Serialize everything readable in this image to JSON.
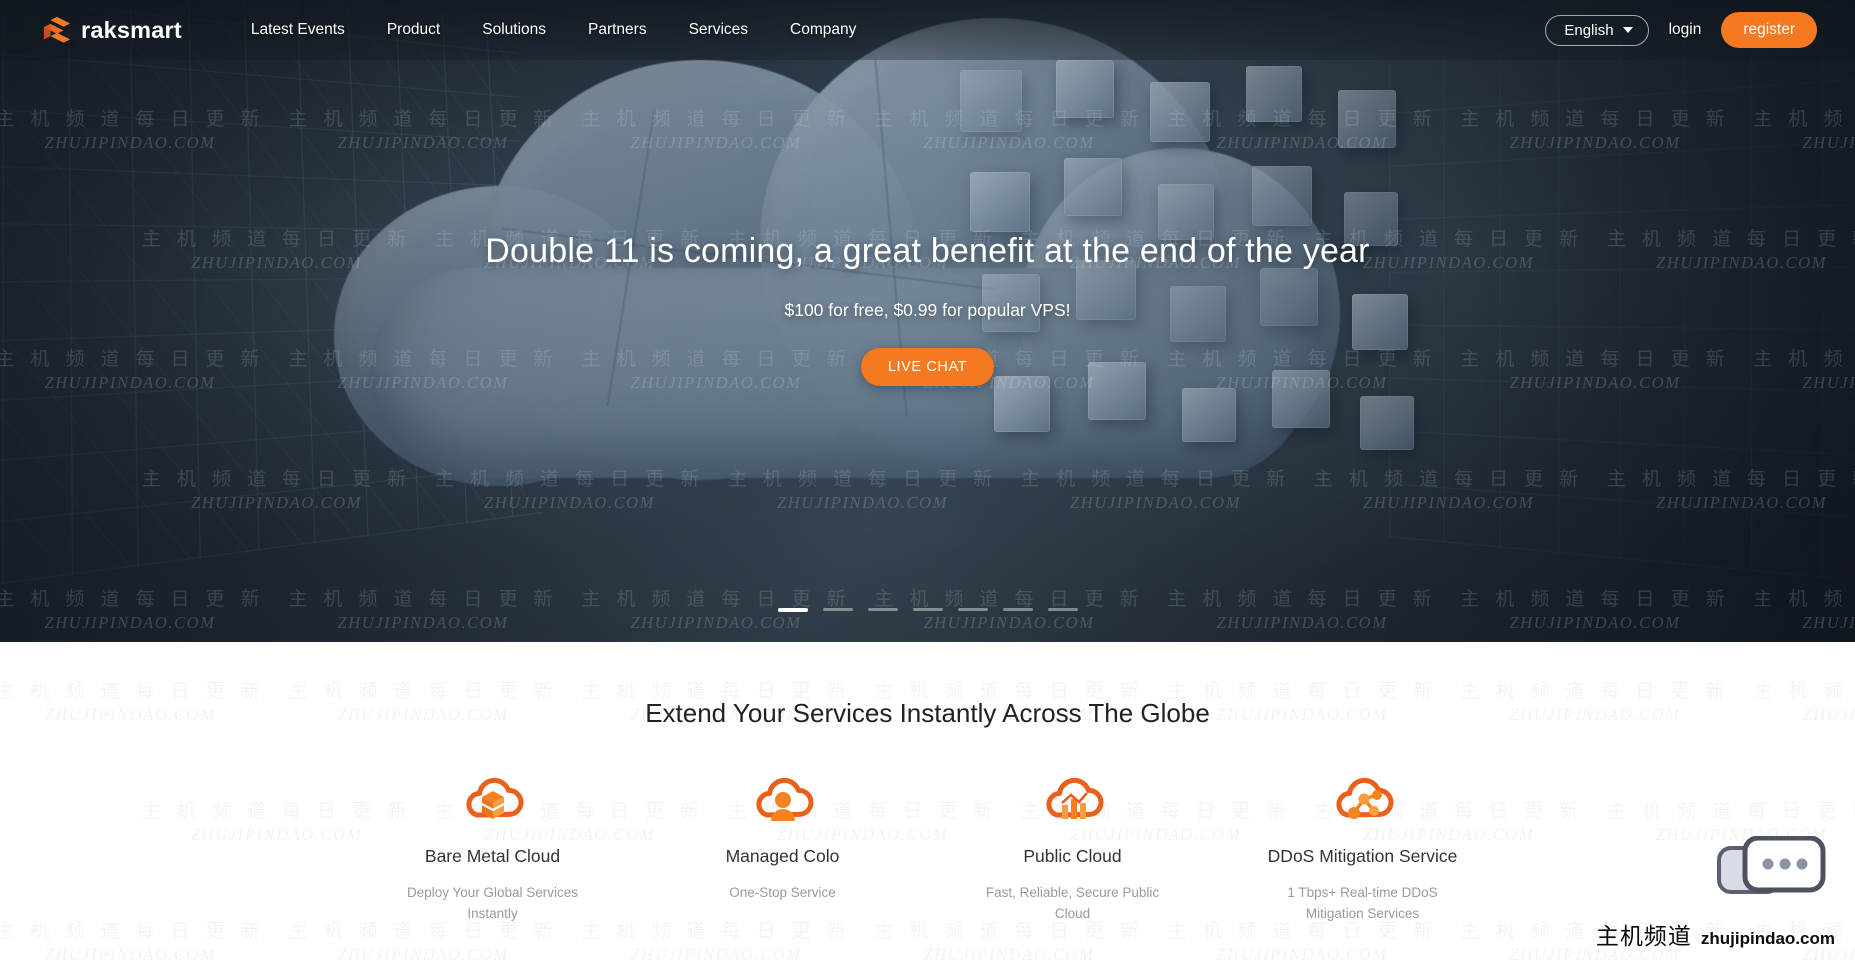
{
  "brand": {
    "name": "raksmart",
    "logo_icon": "raksmart-layers-logo",
    "accent_color": "#f47920"
  },
  "header": {
    "nav": [
      {
        "label": "Latest Events"
      },
      {
        "label": "Product"
      },
      {
        "label": "Solutions"
      },
      {
        "label": "Partners"
      },
      {
        "label": "Services"
      },
      {
        "label": "Company"
      }
    ],
    "language": {
      "label": "English",
      "caret_icon": "chevron-down-icon"
    },
    "login_label": "login",
    "register_label": "register"
  },
  "hero": {
    "title": "Double 11 is coming, a great benefit at the end of the year",
    "subtitle": "$100 for free, $0.99 for popular VPS!",
    "cta_label": "LIVE CHAT",
    "carousel": {
      "total": 7,
      "active_index": 0
    }
  },
  "services": {
    "heading": "Extend Your Services Instantly Across The Globe",
    "cards": [
      {
        "icon": "cloud-server-stack-icon",
        "title": "Bare Metal Cloud",
        "desc": "Deploy Your Global Services Instantly"
      },
      {
        "icon": "cloud-managed-person-icon",
        "title": "Managed Colo",
        "desc": "One-Stop Service"
      },
      {
        "icon": "cloud-bar-chart-icon",
        "title": "Public Cloud",
        "desc": "Fast, Reliable, Secure Public Cloud"
      },
      {
        "icon": "cloud-network-nodes-icon",
        "title": "DDoS Mitigation Service",
        "desc": "1 Tbps+ Real-time DDoS Mitigation Services"
      }
    ]
  },
  "chat_widget": {
    "icon": "chat-bubble-dots-icon"
  },
  "watermark": {
    "cn": "主 机 频 道   每 日 更 新",
    "en": "ZHUJIPINDAO.COM",
    "corner_cn": "主机频道",
    "corner_en": "zhujipindao.com"
  }
}
